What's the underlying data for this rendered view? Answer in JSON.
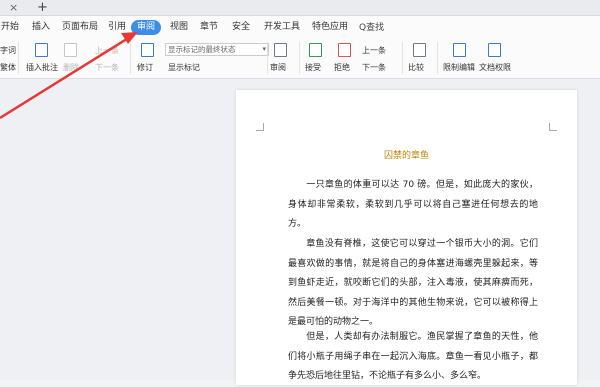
{
  "tabs": {
    "close_glyph": "×",
    "new_tab_glyph": "+"
  },
  "menu": {
    "items": [
      "开始",
      "插入",
      "页面布局",
      "引用",
      "审阅",
      "视图",
      "章节",
      "安全",
      "开发工具",
      "特色应用"
    ],
    "active_index": 4,
    "search_label": "Q查找"
  },
  "ribbon": {
    "left_top": "字词",
    "left_bottom": "繁体",
    "insert_comment": "插入批注",
    "delete": "删除",
    "prev": "上一条",
    "next": "下一条",
    "track": "修订",
    "display_mode": "显示标记的最终状态",
    "display_mark": "显示标记",
    "review": "审阅",
    "accept": "接受",
    "reject": "拒绝",
    "prev2": "上一条",
    "next2": "下一条",
    "compare": "比较",
    "restrict": "限制编辑",
    "permission": "文档权限"
  },
  "document": {
    "title": "囚禁的章鱼",
    "paragraphs": [
      "一只章鱼的体重可以达 70 磅。但是，如此庞大的家伙，身体却非常柔软，柔软到几乎可以将自己塞进任何想去的地方。",
      "章鱼没有脊椎，这使它可以穿过一个银币大小的洞。它们最喜欢做的事情，就是将自己的身体塞进海螺壳里躲起来，等到鱼虾走近，就咬断它们的头部，注入毒液，使其麻痹而死，然后美餐一顿。对于海洋中的其他生物来说，它可以被称得上是最可怕的动物之一。",
      "但是，人类却有办法制服它。渔民掌握了章鱼的天性，他们将小瓶子用绳子串在一起沉入海底。章鱼一看见小瓶子，都争先恐后地往里钻，不论瓶子有多么小、多么窄。"
    ]
  },
  "colors": {
    "accent": "#3b8de8",
    "title": "#b8860b",
    "arrow": "#e53935"
  }
}
